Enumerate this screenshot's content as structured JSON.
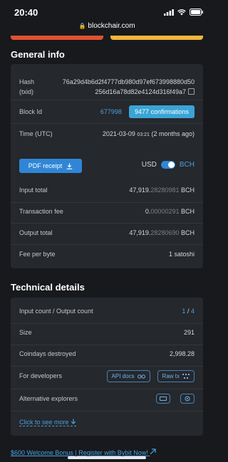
{
  "status": {
    "time": "20:40"
  },
  "browser": {
    "url": "blockchair.com"
  },
  "general": {
    "title": "General info",
    "hash_label": "Hash",
    "hash_sub_label": "(txid)",
    "hash_line1": "76a29d4b6d2f4777db980d97ef673998880d50",
    "hash_line2": "256d16a78d82e4124d316f49a7",
    "block_label": "Block Id",
    "block_value": "677998",
    "confirmations": "9477 confirmations",
    "time_label": "Time (UTC)",
    "time_date": "2021-03-09",
    "time_clock": "03:21",
    "time_ago": "(2 months ago)",
    "pdf_label": "PDF receipt",
    "currency_usd": "USD",
    "currency_bch": "BCH",
    "input_total_label": "Input total",
    "input_total_main": "47,919.",
    "input_total_dec": "28280981",
    "fee_label": "Transaction fee",
    "fee_main": "0.",
    "fee_dec": "00000291",
    "output_total_label": "Output total",
    "output_total_main": "47,919.",
    "output_total_dec": "28280690",
    "unit": "BCH",
    "fee_per_byte_label": "Fee per byte",
    "fee_per_byte_value": "1 satoshi"
  },
  "technical": {
    "title": "Technical details",
    "count_label": "Input count / Output count",
    "input_count": "1",
    "slash": "/",
    "output_count": "4",
    "size_label": "Size",
    "size_value": "291",
    "coindays_label": "Coindays destroyed",
    "coindays_value": "2,998.28",
    "dev_label": "For developers",
    "api_docs": "API docs",
    "raw_tx": "Raw tx",
    "alt_label": "Alternative explorers",
    "more_link": "Click to see more"
  },
  "promo": {
    "text": "$600 Welcome Bonus | Register with Bybit Now!"
  },
  "colors": {
    "accent": "#2f86d6",
    "link": "#4a9fe0",
    "background": "#17191c",
    "card": "#25282c"
  }
}
